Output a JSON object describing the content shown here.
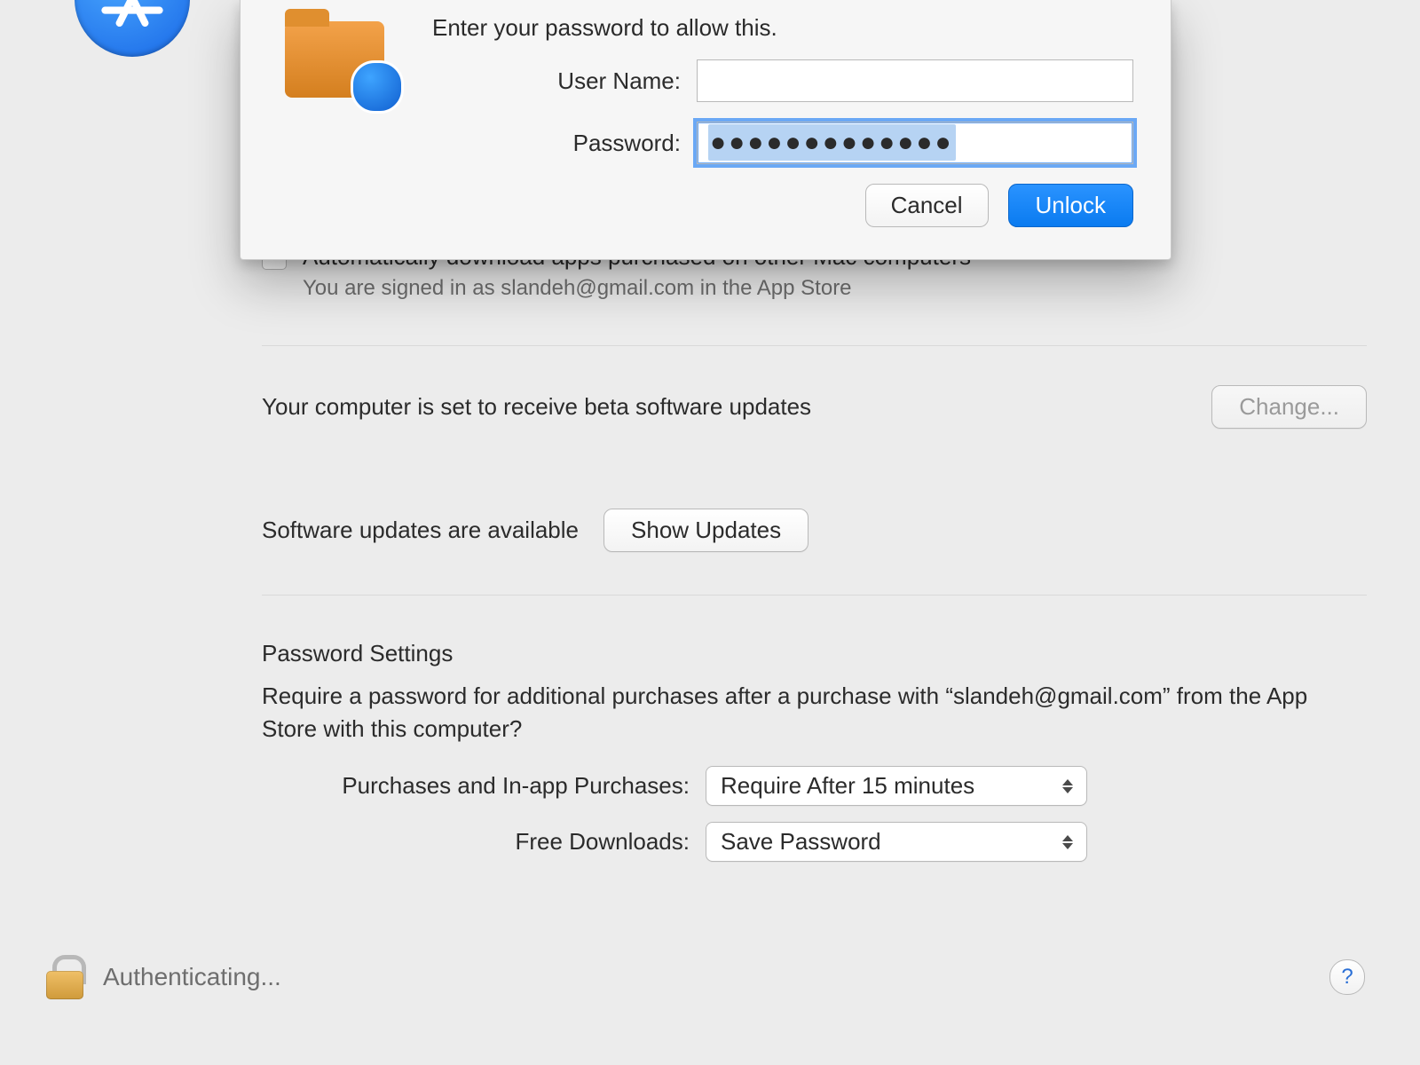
{
  "appstore_icon_name": "app-store-icon",
  "dialog": {
    "title": "Enter your password to allow this.",
    "username_label": "User Name:",
    "username_value": "",
    "password_label": "Password:",
    "password_dots": "●●●●●●●●●●●●●",
    "cancel": "Cancel",
    "unlock": "Unlock"
  },
  "prefs": {
    "auto_download_label": "Automatically download apps purchased on other Mac computers",
    "signed_in_sub": "You are signed in as slandeh@gmail.com in the App Store",
    "beta_text": "Your computer is set to receive beta software updates",
    "change_btn": "Change...",
    "updates_text": "Software updates are available",
    "show_updates_btn": "Show Updates",
    "password_heading": "Password Settings",
    "password_desc": "Require a password for additional purchases after a purchase with “slandeh@gmail.com” from the App Store with this computer?",
    "purchases_label": "Purchases and In-app Purchases:",
    "purchases_value": "Require After 15 minutes",
    "free_label": "Free Downloads:",
    "free_value": "Save Password"
  },
  "footer": {
    "status": "Authenticating...",
    "help": "?"
  }
}
